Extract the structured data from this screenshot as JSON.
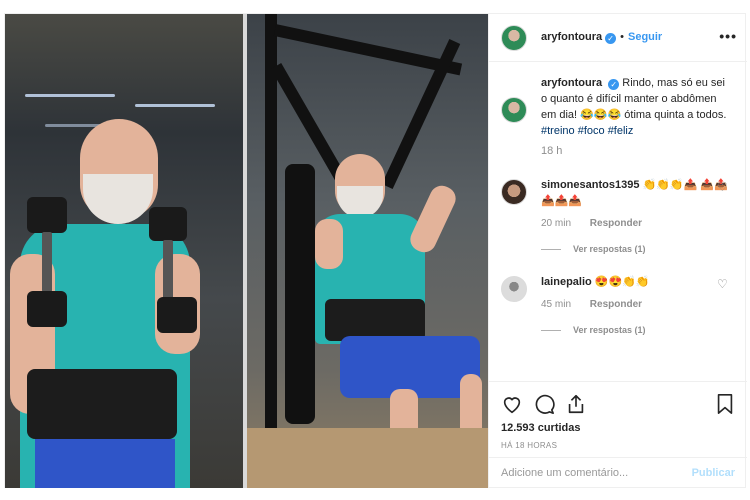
{
  "post": {
    "account": {
      "username": "aryfontoura",
      "verified": true,
      "follow_label": "Seguir",
      "more_icon": "ellipsis-icon"
    },
    "caption": {
      "username": "aryfontoura",
      "text": "Rindo, mas só eu sei o quanto é difícil manter o abdômen em dia! 😂😂😂 ótima quinta a todos.",
      "hashtags": [
        "#treino",
        "#foco",
        "#feliz"
      ],
      "time": "18 h"
    },
    "comments": [
      {
        "username": "simonesantos1395",
        "text": "👏👏👏📤 📤📤📤📤📤",
        "time": "20 min",
        "reply_label": "Responder",
        "view_replies": "Ver respostas (1)"
      },
      {
        "username": "lainepalio",
        "text": "😍😍👏👏",
        "time": "45 min",
        "reply_label": "Responder",
        "view_replies": "Ver respostas (1)"
      }
    ],
    "likes": "12.593 curtidas",
    "posted_ago": "HÁ 18 HORAS",
    "comment_box": {
      "placeholder": "Adicione um comentário...",
      "publish_label": "Publicar"
    },
    "colors": {
      "link_blue": "#3897f0",
      "hashtag": "#003569",
      "muted": "#8e8e8e",
      "publish_disabled": "#b2dffc"
    }
  }
}
